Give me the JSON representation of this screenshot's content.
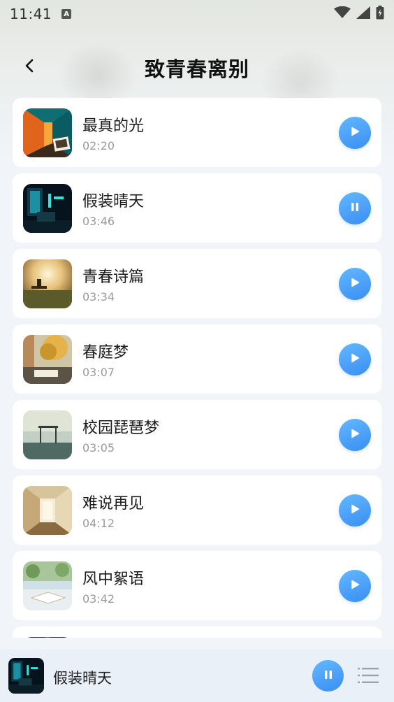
{
  "status_bar": {
    "time": "11:41",
    "notification_icon": "A",
    "icons": [
      "wifi-icon",
      "signal-icon",
      "battery-charging-icon"
    ]
  },
  "header": {
    "title": "致青春离别",
    "back_icon": "chevron-left-icon"
  },
  "songs": [
    {
      "title": "最真的光",
      "duration": "02:20",
      "state": "play"
    },
    {
      "title": "假装晴天",
      "duration": "03:46",
      "state": "pause"
    },
    {
      "title": "青春诗篇",
      "duration": "03:34",
      "state": "play"
    },
    {
      "title": "春庭梦",
      "duration": "03:07",
      "state": "play"
    },
    {
      "title": "校园琵琶梦",
      "duration": "03:05",
      "state": "play"
    },
    {
      "title": "难说再见",
      "duration": "04:12",
      "state": "play"
    },
    {
      "title": "风中絮语",
      "duration": "03:42",
      "state": "play"
    }
  ],
  "player": {
    "now_playing": "假装晴天",
    "state": "pause",
    "playlist_icon": "playlist-icon"
  },
  "colors": {
    "accent": "#3a8ef2",
    "accent_light": "#63b8ff",
    "card": "#ffffff",
    "background": "#f1f4f8"
  }
}
